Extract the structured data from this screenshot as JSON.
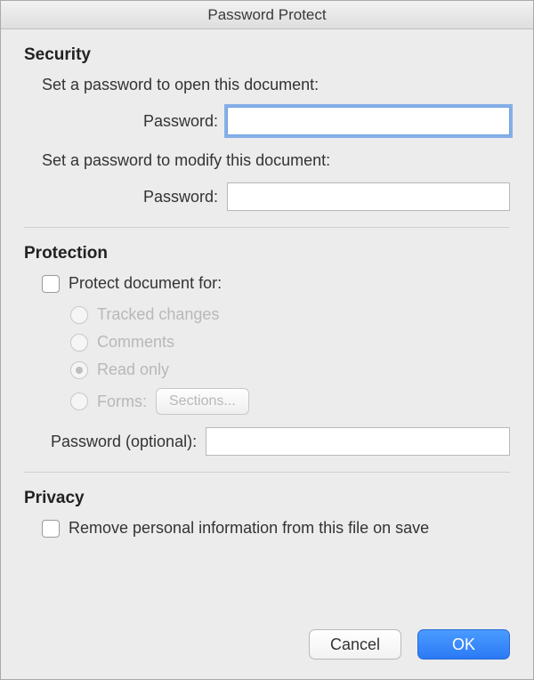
{
  "title": "Password Protect",
  "security": {
    "heading": "Security",
    "open_instruction": "Set a password to open this document:",
    "open_password_label": "Password:",
    "open_password_value": "",
    "modify_instruction": "Set a password to modify this document:",
    "modify_password_label": "Password:",
    "modify_password_value": ""
  },
  "protection": {
    "heading": "Protection",
    "protect_checkbox_label": "Protect document for:",
    "protect_enabled": false,
    "radios": {
      "tracked_changes": "Tracked changes",
      "comments": "Comments",
      "read_only": "Read only",
      "forms": "Forms:"
    },
    "selected_radio": "read_only",
    "sections_button": "Sections...",
    "password_label": "Password (optional):",
    "password_value": ""
  },
  "privacy": {
    "heading": "Privacy",
    "remove_pii_label": "Remove personal information from this file on save",
    "remove_pii_checked": false
  },
  "buttons": {
    "cancel": "Cancel",
    "ok": "OK"
  }
}
